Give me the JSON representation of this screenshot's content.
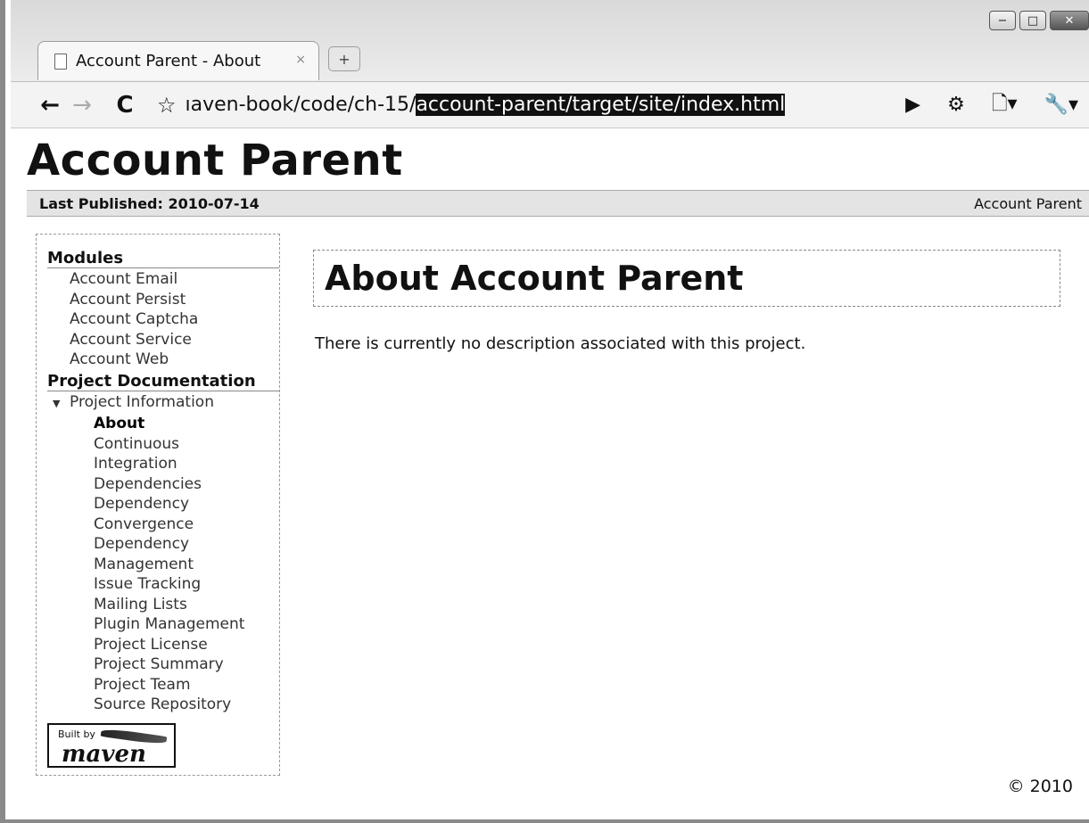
{
  "browser": {
    "tab_title": "Account Parent - About",
    "tab_close": "×",
    "new_tab_icon": "+",
    "url_prefix": "ıaven-book/code/ch-15/",
    "url_selected": "account-parent/target/site/index.html",
    "window_controls": {
      "minimize": "−",
      "maximize": "□",
      "close": "✕"
    }
  },
  "page": {
    "title": "Account Parent",
    "last_published": "Last Published: 2010-07-14",
    "breadcrumb_right": "Account Parent",
    "content_title": "About Account Parent",
    "description": "There is currently no description associated with this project.",
    "copyright": "© 2010"
  },
  "sidebar": {
    "modules_heading": "Modules",
    "modules": [
      "Account Email",
      "Account Persist",
      "Account Captcha",
      "Account Service",
      "Account Web"
    ],
    "docs_heading": "Project Documentation",
    "project_info": "Project Information",
    "info_items": [
      "About",
      "Continuous",
      "Integration",
      "Dependencies",
      "Dependency",
      "Convergence",
      "Dependency",
      "Management",
      "Issue Tracking",
      "Mailing Lists",
      "Plugin Management",
      "Project License",
      "Project Summary",
      "Project Team",
      "Source Repository"
    ],
    "built_by": "Built by",
    "maven": "maven"
  }
}
